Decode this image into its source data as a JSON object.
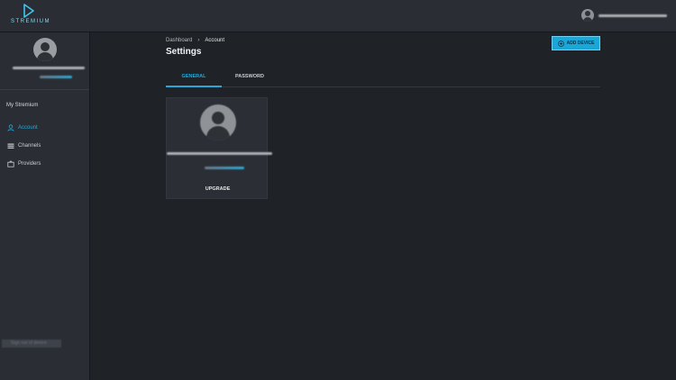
{
  "app": {
    "logo_text": "STREMIUM"
  },
  "sidebar": {
    "section_title": "My Stremium",
    "items": [
      {
        "label": "Account",
        "icon": "user-icon",
        "active": true
      },
      {
        "label": "Channels",
        "icon": "channels-icon",
        "active": false
      },
      {
        "label": "Providers",
        "icon": "providers-icon",
        "active": false
      }
    ],
    "bottom_label": "Sign out of device"
  },
  "breadcrumb": {
    "parent": "Dashboard",
    "separator": "›",
    "current": "Account"
  },
  "page": {
    "title": "Settings"
  },
  "actions": {
    "add_device": "ADD DEVICE"
  },
  "tabs": [
    {
      "label": "GENERAL",
      "active": true
    },
    {
      "label": "PASSWORD",
      "active": false
    }
  ],
  "card": {
    "upgrade_label": "UPGRADE"
  },
  "colors": {
    "accent": "#27a8d8",
    "button": "#1ba6d8",
    "background": "#1f2227",
    "panel": "#2a2e34"
  }
}
